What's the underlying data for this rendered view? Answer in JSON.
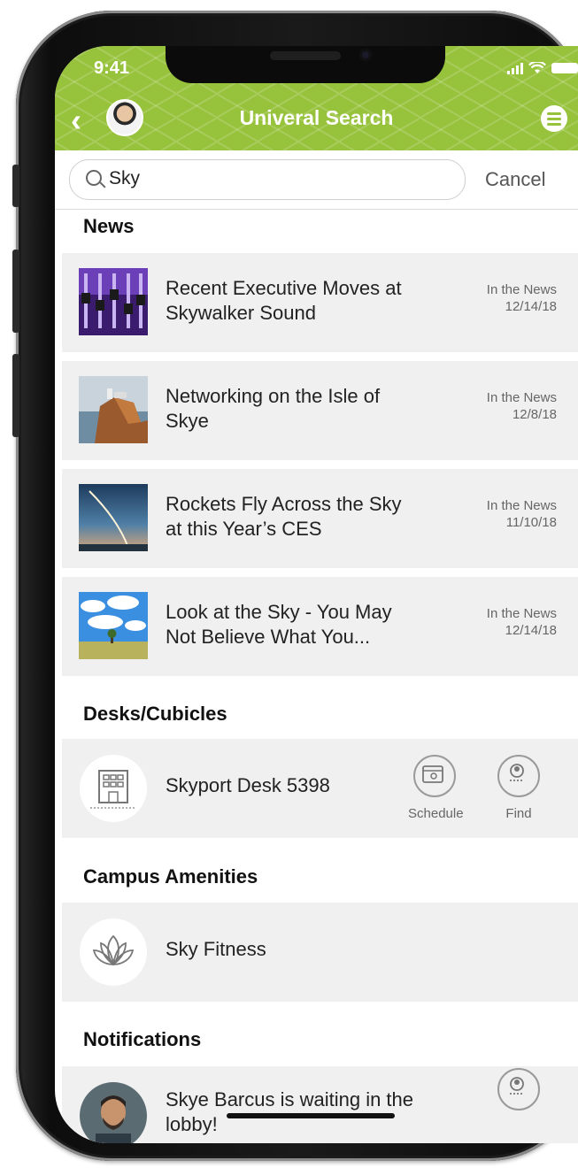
{
  "status_bar": {
    "time": "9:41"
  },
  "header": {
    "title": "Univeral Search"
  },
  "search": {
    "value": "Sky",
    "cancel_label": "Cancel"
  },
  "sections": {
    "news": {
      "title": "News",
      "items": [
        {
          "title": "Recent Executive Moves at Skywalker Sound",
          "source": "In the News",
          "date": "12/14/18"
        },
        {
          "title": "Networking on the Isle of Skye",
          "source": "In the News",
          "date": "12/8/18"
        },
        {
          "title": "Rockets Fly Across the Sky at this Year’s CES",
          "source": "In the News",
          "date": "11/10/18"
        },
        {
          "title": "Look at the Sky - You May Not Believe What You...",
          "source": "In the News",
          "date": "12/14/18"
        }
      ]
    },
    "desks": {
      "title": "Desks/Cubicles",
      "items": [
        {
          "label": "Skyport Desk 5398",
          "schedule_label": "Schedule",
          "find_label": "Find"
        }
      ]
    },
    "amenities": {
      "title": "Campus Amenities",
      "items": [
        {
          "label": "Sky Fitness"
        }
      ]
    },
    "notifications": {
      "title": "Notifications",
      "items": [
        {
          "label": "Skye Barcus is waiting in the lobby!"
        }
      ]
    }
  },
  "colors": {
    "brand_green": "#97c23c",
    "card_bg": "#f0f0f0"
  }
}
